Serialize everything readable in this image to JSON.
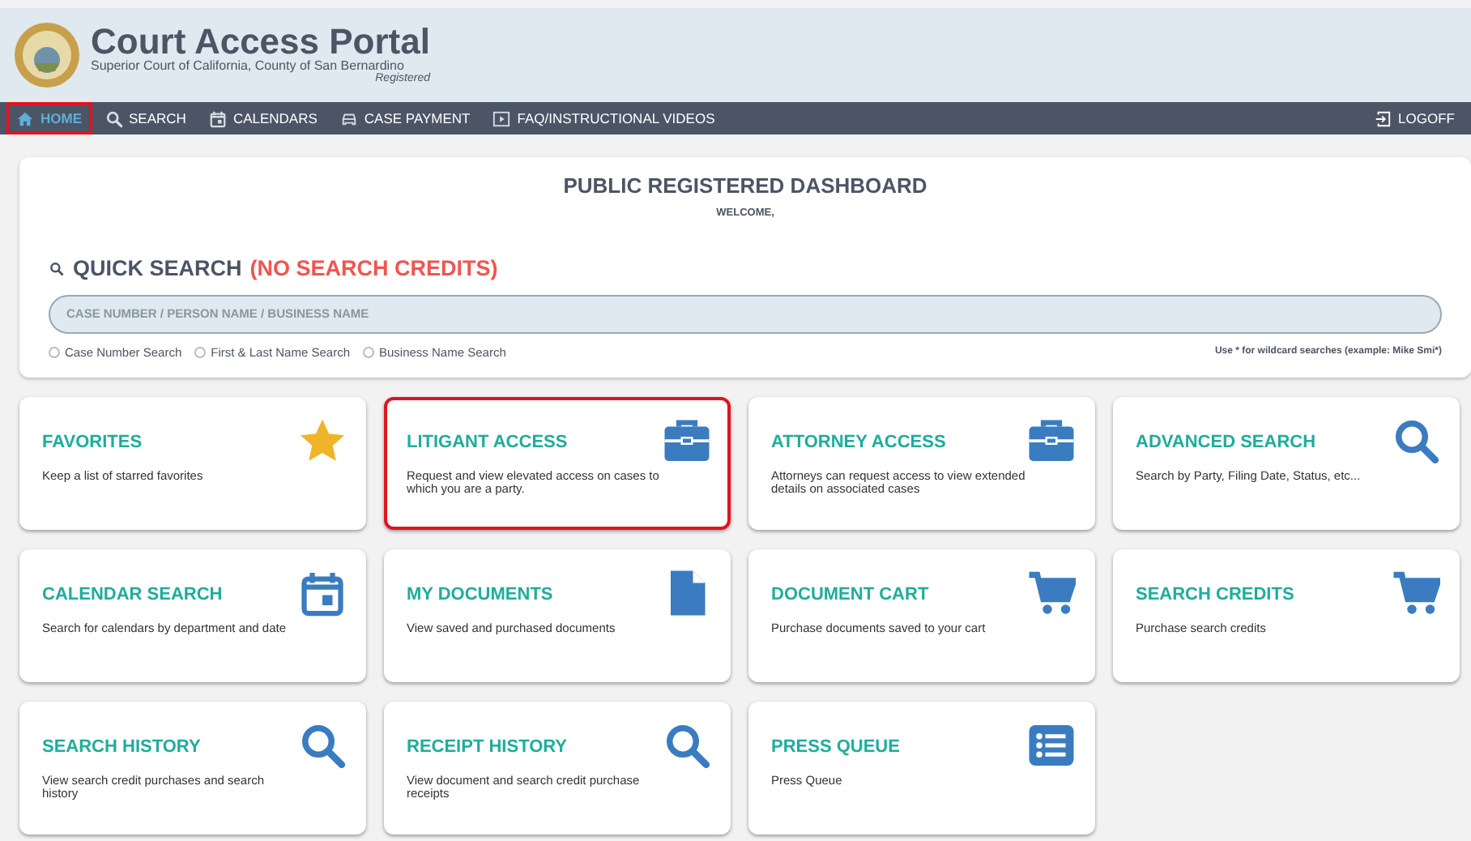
{
  "header": {
    "title": "Court Access Portal",
    "subtitle": "Superior Court of California, County of San Bernardino",
    "role": "Registered"
  },
  "nav": {
    "items": [
      {
        "label": "HOME",
        "kind": "home",
        "selected": true,
        "highlighted": true
      },
      {
        "label": "SEARCH",
        "kind": "search",
        "selected": false,
        "highlighted": false
      },
      {
        "label": "CALENDARS",
        "kind": "calendar",
        "selected": false,
        "highlighted": false
      },
      {
        "label": "CASE PAYMENT",
        "kind": "car",
        "selected": false,
        "highlighted": false
      },
      {
        "label": "FAQ/INSTRUCTIONAL VIDEOS",
        "kind": "video",
        "selected": false,
        "highlighted": false
      }
    ],
    "logoff": "LOGOFF"
  },
  "dashboard": {
    "title": "PUBLIC REGISTERED DASHBOARD",
    "welcome": "WELCOME,",
    "quick_search": "QUICK SEARCH",
    "credits_note": "(NO SEARCH CREDITS)",
    "placeholder": "CASE NUMBER / PERSON NAME / BUSINESS NAME",
    "options": [
      {
        "label": "Case Number Search",
        "selected": false
      },
      {
        "label": "First & Last Name Search",
        "selected": false
      },
      {
        "label": "Business Name Search",
        "selected": false
      }
    ],
    "hint": "Use * for wildcard searches (example: Mike Smi*)"
  },
  "tiles": [
    {
      "title": "FAVORITES",
      "text": "Keep a list of starred favorites",
      "kind": "star",
      "highlighted": false
    },
    {
      "title": "LITIGANT ACCESS",
      "text": "Request and view elevated access on cases to which you are a party.",
      "kind": "briefcase",
      "highlighted": true
    },
    {
      "title": "ATTORNEY ACCESS",
      "text": "Attorneys can request access to view extended details on associated cases",
      "kind": "briefcase",
      "highlighted": false
    },
    {
      "title": "ADVANCED SEARCH",
      "text": "Search by Party, Filing Date, Status, etc...",
      "kind": "search",
      "highlighted": false
    },
    {
      "title": "CALENDAR SEARCH",
      "text": "Search for calendars by department and date",
      "kind": "calendar",
      "highlighted": false
    },
    {
      "title": "MY DOCUMENTS",
      "text": "View saved and purchased documents",
      "kind": "document",
      "highlighted": false
    },
    {
      "title": "DOCUMENT CART",
      "text": "Purchase documents saved to your cart",
      "kind": "cart",
      "highlighted": false
    },
    {
      "title": "SEARCH CREDITS",
      "text": "Purchase search credits",
      "kind": "cart",
      "highlighted": false
    },
    {
      "title": "SEARCH HISTORY",
      "text": "View search credit purchases and search history",
      "kind": "search",
      "highlighted": false
    },
    {
      "title": "RECEIPT HISTORY",
      "text": "View document and search credit purchase receipts",
      "kind": "search",
      "highlighted": false
    },
    {
      "title": "PRESS QUEUE",
      "text": "Press Queue",
      "kind": "list",
      "highlighted": false
    }
  ]
}
